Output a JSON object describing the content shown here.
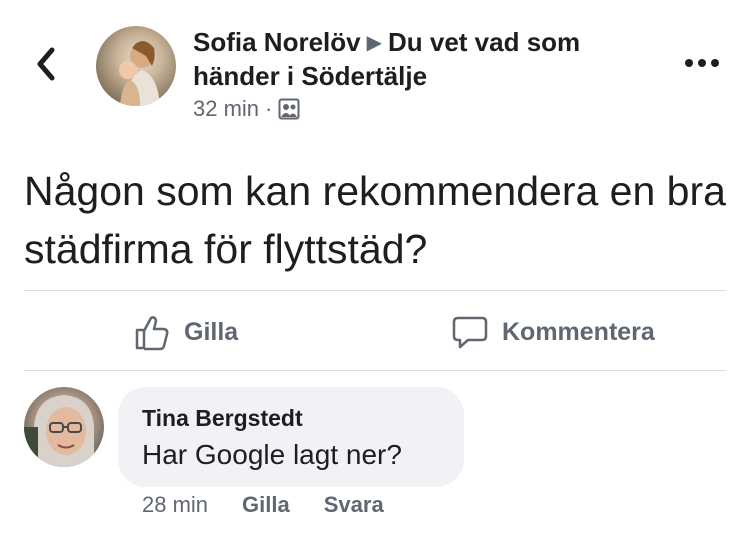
{
  "header": {
    "author": "Sofia Norelöv",
    "group": "Du vet vad som händer i Södertälje",
    "time": "32 min",
    "separator": "·"
  },
  "post": {
    "text": "Någon som kan rekommendera en bra städfirma för flyttstäd?"
  },
  "actions": {
    "like_label": "Gilla",
    "comment_label": "Kommentera"
  },
  "comment": {
    "author": "Tina Bergstedt",
    "text": "Har Google lagt ner?",
    "time": "28 min",
    "like_label": "Gilla",
    "reply_label": "Svara"
  },
  "icons": {
    "back": "chevron-left-icon",
    "more": "more-dots-icon",
    "audience": "group-audience-icon",
    "like": "thumbs-up-icon",
    "comment": "speech-bubble-icon"
  },
  "colors": {
    "text": "#1c1e21",
    "secondary": "#606770",
    "bubble": "#f0f2f5",
    "divider": "#dadde1"
  }
}
